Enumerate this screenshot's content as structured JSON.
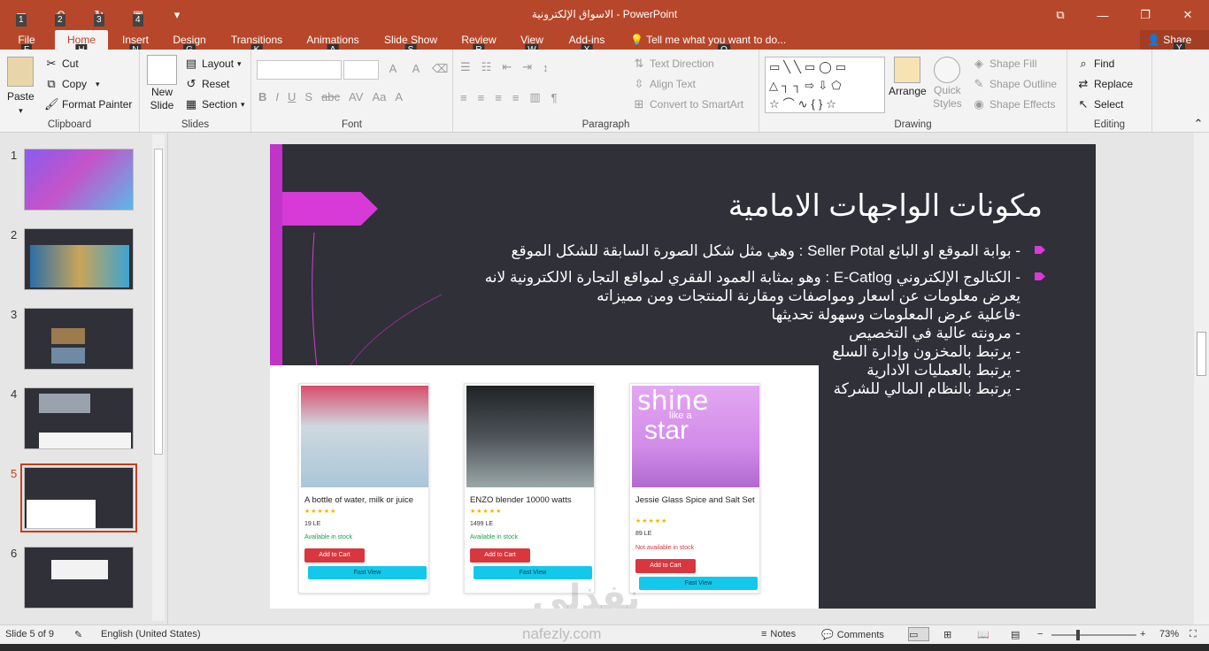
{
  "window": {
    "title": "الاسواق الإلكترونية - PowerPoint",
    "qat_keys": [
      "1",
      "2",
      "3",
      "4"
    ]
  },
  "tabs": [
    {
      "label": "File",
      "key": "F"
    },
    {
      "label": "Home",
      "key": "H"
    },
    {
      "label": "Insert",
      "key": "N"
    },
    {
      "label": "Design",
      "key": "G"
    },
    {
      "label": "Transitions",
      "key": "K"
    },
    {
      "label": "Animations",
      "key": "A"
    },
    {
      "label": "Slide Show",
      "key": "S"
    },
    {
      "label": "Review",
      "key": "R"
    },
    {
      "label": "View",
      "key": "W"
    },
    {
      "label": "Add-ins",
      "key": "X"
    }
  ],
  "tell_me": "Tell me what you want to do...",
  "tell_me_key": "Q",
  "share": "Share",
  "share_key": "Y",
  "ribbon": {
    "clipboard": {
      "label": "Clipboard",
      "paste": "Paste",
      "cut": "Cut",
      "copy": "Copy",
      "format_painter": "Format Painter"
    },
    "slides": {
      "label": "Slides",
      "new_slide": "New",
      "new_slide2": "Slide",
      "layout": "Layout",
      "reset": "Reset",
      "section": "Section"
    },
    "font": {
      "label": "Font"
    },
    "paragraph": {
      "label": "Paragraph",
      "text_direction": "Text Direction",
      "align_text": "Align Text",
      "smartart": "Convert to SmartArt"
    },
    "drawing": {
      "label": "Drawing",
      "arrange": "Arrange",
      "quick_styles": "Quick",
      "quick_styles2": "Styles",
      "shape_fill": "Shape Fill",
      "shape_outline": "Shape Outline",
      "shape_effects": "Shape Effects"
    },
    "editing": {
      "label": "Editing",
      "find": "Find",
      "replace": "Replace",
      "select": "Select"
    }
  },
  "thumbnails": [
    "1",
    "2",
    "3",
    "4",
    "5",
    "6"
  ],
  "active_slide": 5,
  "slide": {
    "title": "مكونات الواجهات الامامية",
    "bullet1": "- بوابة الموقع او البائع Seller Potal : وهي مثل شكل الصورة السابقة للشكل الموقع",
    "bullet2_lines": [
      "- الكتالوج الإلكتروني E-Catlog : وهو بمثابة العمود الفقري لمواقع التجارة الالكترونية لانه",
      "يعرض معلومات عن اسعار ومواصفات ومقارنة المنتجات ومن مميزاته",
      "-فاعلية عرض المعلومات وسهولة تحديثها",
      "- مرونته عالية في التخصيص",
      "- يرتبط بالمخزون وإدارة السلع",
      "- يرتبط بالعمليات الادارية",
      "- يرتبط بالنظام المالي للشركة"
    ]
  },
  "products": [
    {
      "name": "A bottle of water, milk or juice",
      "price": "19 LE",
      "stock": "Available in stock",
      "add": "Add to Cart",
      "fast": "Fast View"
    },
    {
      "name": "ENZO blender 10000 watts",
      "price": "1499 LE",
      "stock": "Available in stock",
      "add": "Add to Cart",
      "fast": "Fast View"
    },
    {
      "name": "Jessie Glass Spice and Salt Set",
      "price": "89 LE",
      "stock": "Not available in stock",
      "add": "Add to Cart",
      "fast": "Fast View"
    }
  ],
  "product_image_text": {
    "shine": "shine",
    "like_a": "like a",
    "star": "star"
  },
  "stars": "★★★★★",
  "status": {
    "slide_of": "Slide 5 of 9",
    "language": "English (United States)",
    "notes": "Notes",
    "comments": "Comments",
    "zoom": "73%"
  },
  "watermark": {
    "arabic": "نفذلي",
    "latin": "nafezly.com"
  },
  "colors": {
    "accent": "#b7472a",
    "slide_bg": "#2f3038",
    "magenta": "#d73ad6",
    "cart": "#d9363e",
    "fastview": "#13c8ea"
  }
}
